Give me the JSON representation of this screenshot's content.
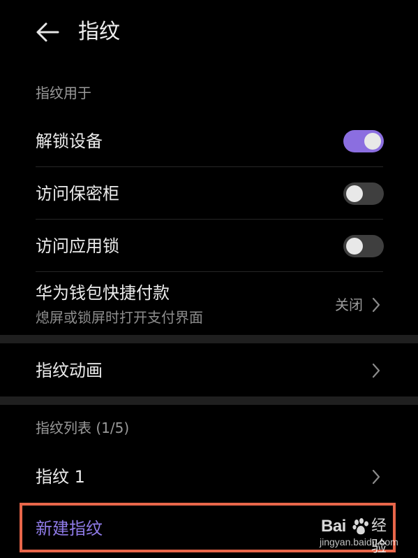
{
  "header": {
    "title": "指纹"
  },
  "section_usage": {
    "label": "指纹用于",
    "items": [
      {
        "title": "解锁设备",
        "toggle": true
      },
      {
        "title": "访问保密柜",
        "toggle": false
      },
      {
        "title": "访问应用锁",
        "toggle": false
      }
    ],
    "wallet": {
      "title": "华为钱包快捷付款",
      "subtitle": "熄屏或锁屏时打开支付界面",
      "value": "关闭"
    }
  },
  "animation": {
    "title": "指纹动画"
  },
  "fingerprint_list": {
    "label": "指纹列表 (1/5)",
    "items": [
      {
        "title": "指纹 1"
      }
    ],
    "new_label": "新建指纹"
  },
  "watermark": {
    "brand_left": "Bai",
    "brand_right": "经验",
    "url": "jingyan.baidu.com"
  },
  "colors": {
    "background": "#000000",
    "accent": "#8b6ee0",
    "highlight_frame": "#e8664a",
    "section_gap": "#1f1f1f"
  }
}
